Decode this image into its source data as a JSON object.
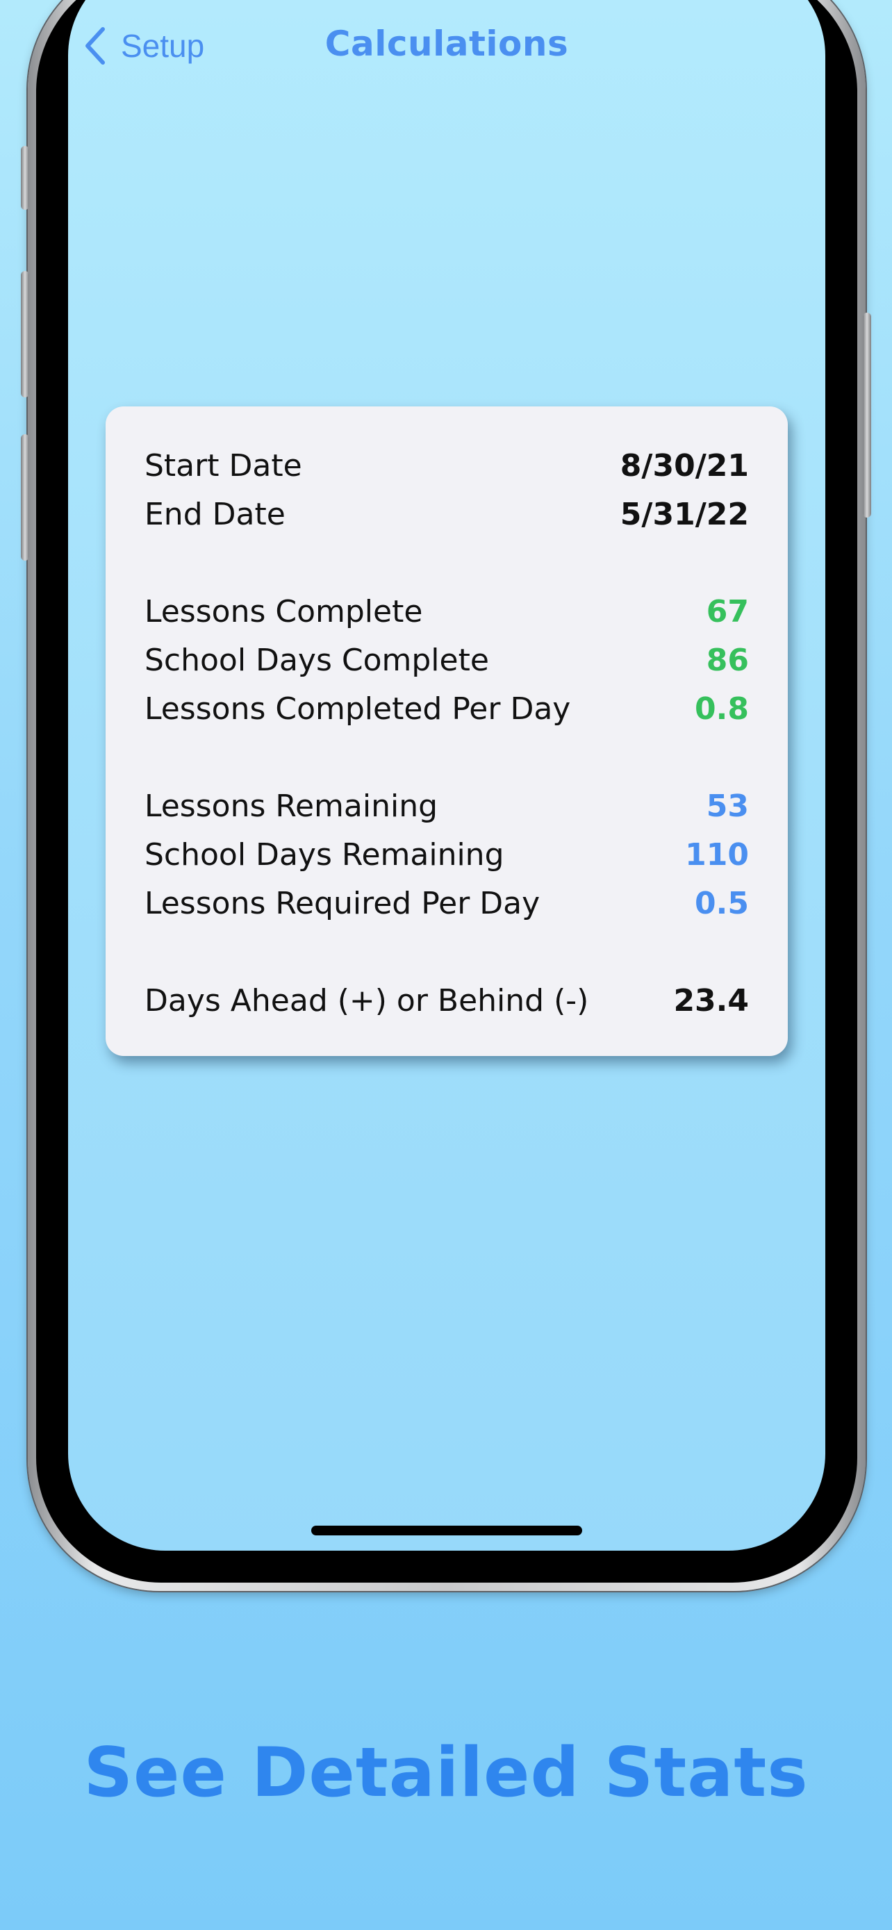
{
  "nav": {
    "back_label": "Setup",
    "title": "Calculations",
    "back_icon": "chevron-left-icon"
  },
  "stats": {
    "start_date": {
      "label": "Start Date",
      "value": "8/30/21"
    },
    "end_date": {
      "label": "End Date",
      "value": "5/31/22"
    },
    "lessons_complete": {
      "label": "Lessons Complete",
      "value": "67"
    },
    "school_days_complete": {
      "label": "School Days Complete",
      "value": "86"
    },
    "lessons_completed_per_day": {
      "label": "Lessons Completed Per Day",
      "value": "0.8"
    },
    "lessons_remaining": {
      "label": "Lessons Remaining",
      "value": "53"
    },
    "school_days_remaining": {
      "label": "School Days Remaining",
      "value": "110"
    },
    "lessons_required_per_day": {
      "label": "Lessons Required Per Day",
      "value": "0.5"
    },
    "days_ahead_behind": {
      "label": "Days Ahead (+) or Behind (-)",
      "value": "23.4"
    }
  },
  "caption": "See Detailed Stats",
  "colors": {
    "accent_blue": "#4a8ff0",
    "complete_green": "#36c05c",
    "card_background": "#f2f2f6",
    "caption_blue": "#2f86ee"
  }
}
